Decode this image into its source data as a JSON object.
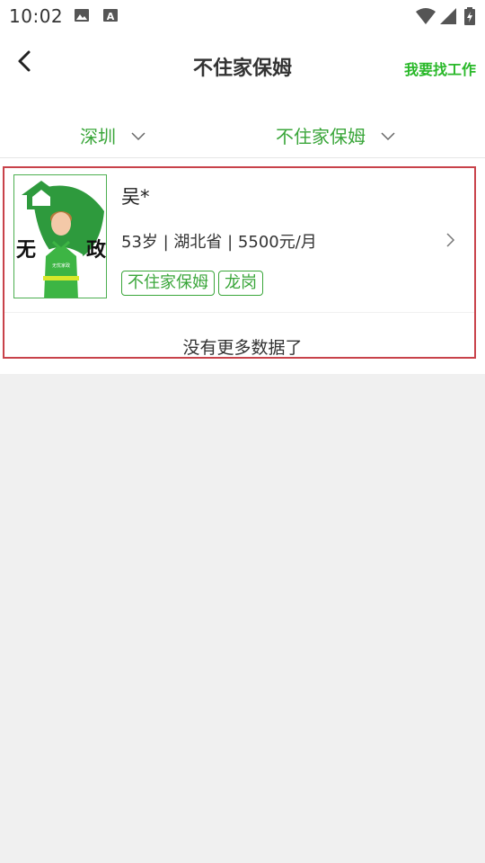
{
  "status_bar": {
    "time": "10:02",
    "icons": [
      "image-icon",
      "text-a-icon",
      "wifi-icon",
      "signal-icon",
      "battery-charging-icon"
    ]
  },
  "header": {
    "title": "不住家保姆",
    "action_label": "我要找工作",
    "back_icon": "chevron-left-icon"
  },
  "filters": [
    {
      "label": "深圳",
      "icon": "chevron-down-icon"
    },
    {
      "label": "不住家保姆",
      "icon": "chevron-down-icon"
    }
  ],
  "listings": [
    {
      "name": "吴*",
      "info": "53岁 | 湖北省 | 5500元/月",
      "tags": [
        "不住家保姆",
        "龙岗"
      ],
      "avatar_logo_text": "无忧家政",
      "avatar_apron_text": "无忧家政"
    }
  ],
  "list_footer": "没有更多数据了",
  "colors": {
    "accent_green": "#3aa63a",
    "header_action_green": "#28b828",
    "highlight_border": "#c8424a",
    "page_background": "#f0f0f0"
  }
}
